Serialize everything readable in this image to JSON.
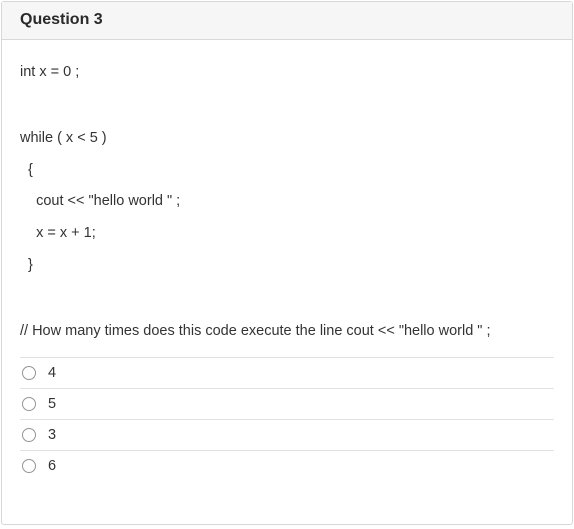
{
  "header": {
    "title": "Question 3"
  },
  "code": {
    "line1": "int x = 0 ;",
    "line2": "while ( x < 5 )",
    "line3": "  {",
    "line4": "    cout << \"hello world \" ;",
    "line5": "    x = x + 1;",
    "line6": "  }"
  },
  "question": "// How many times does this code execute the line cout << \"hello world \" ;",
  "options": [
    {
      "label": "4"
    },
    {
      "label": "5"
    },
    {
      "label": "3"
    },
    {
      "label": "6"
    }
  ]
}
